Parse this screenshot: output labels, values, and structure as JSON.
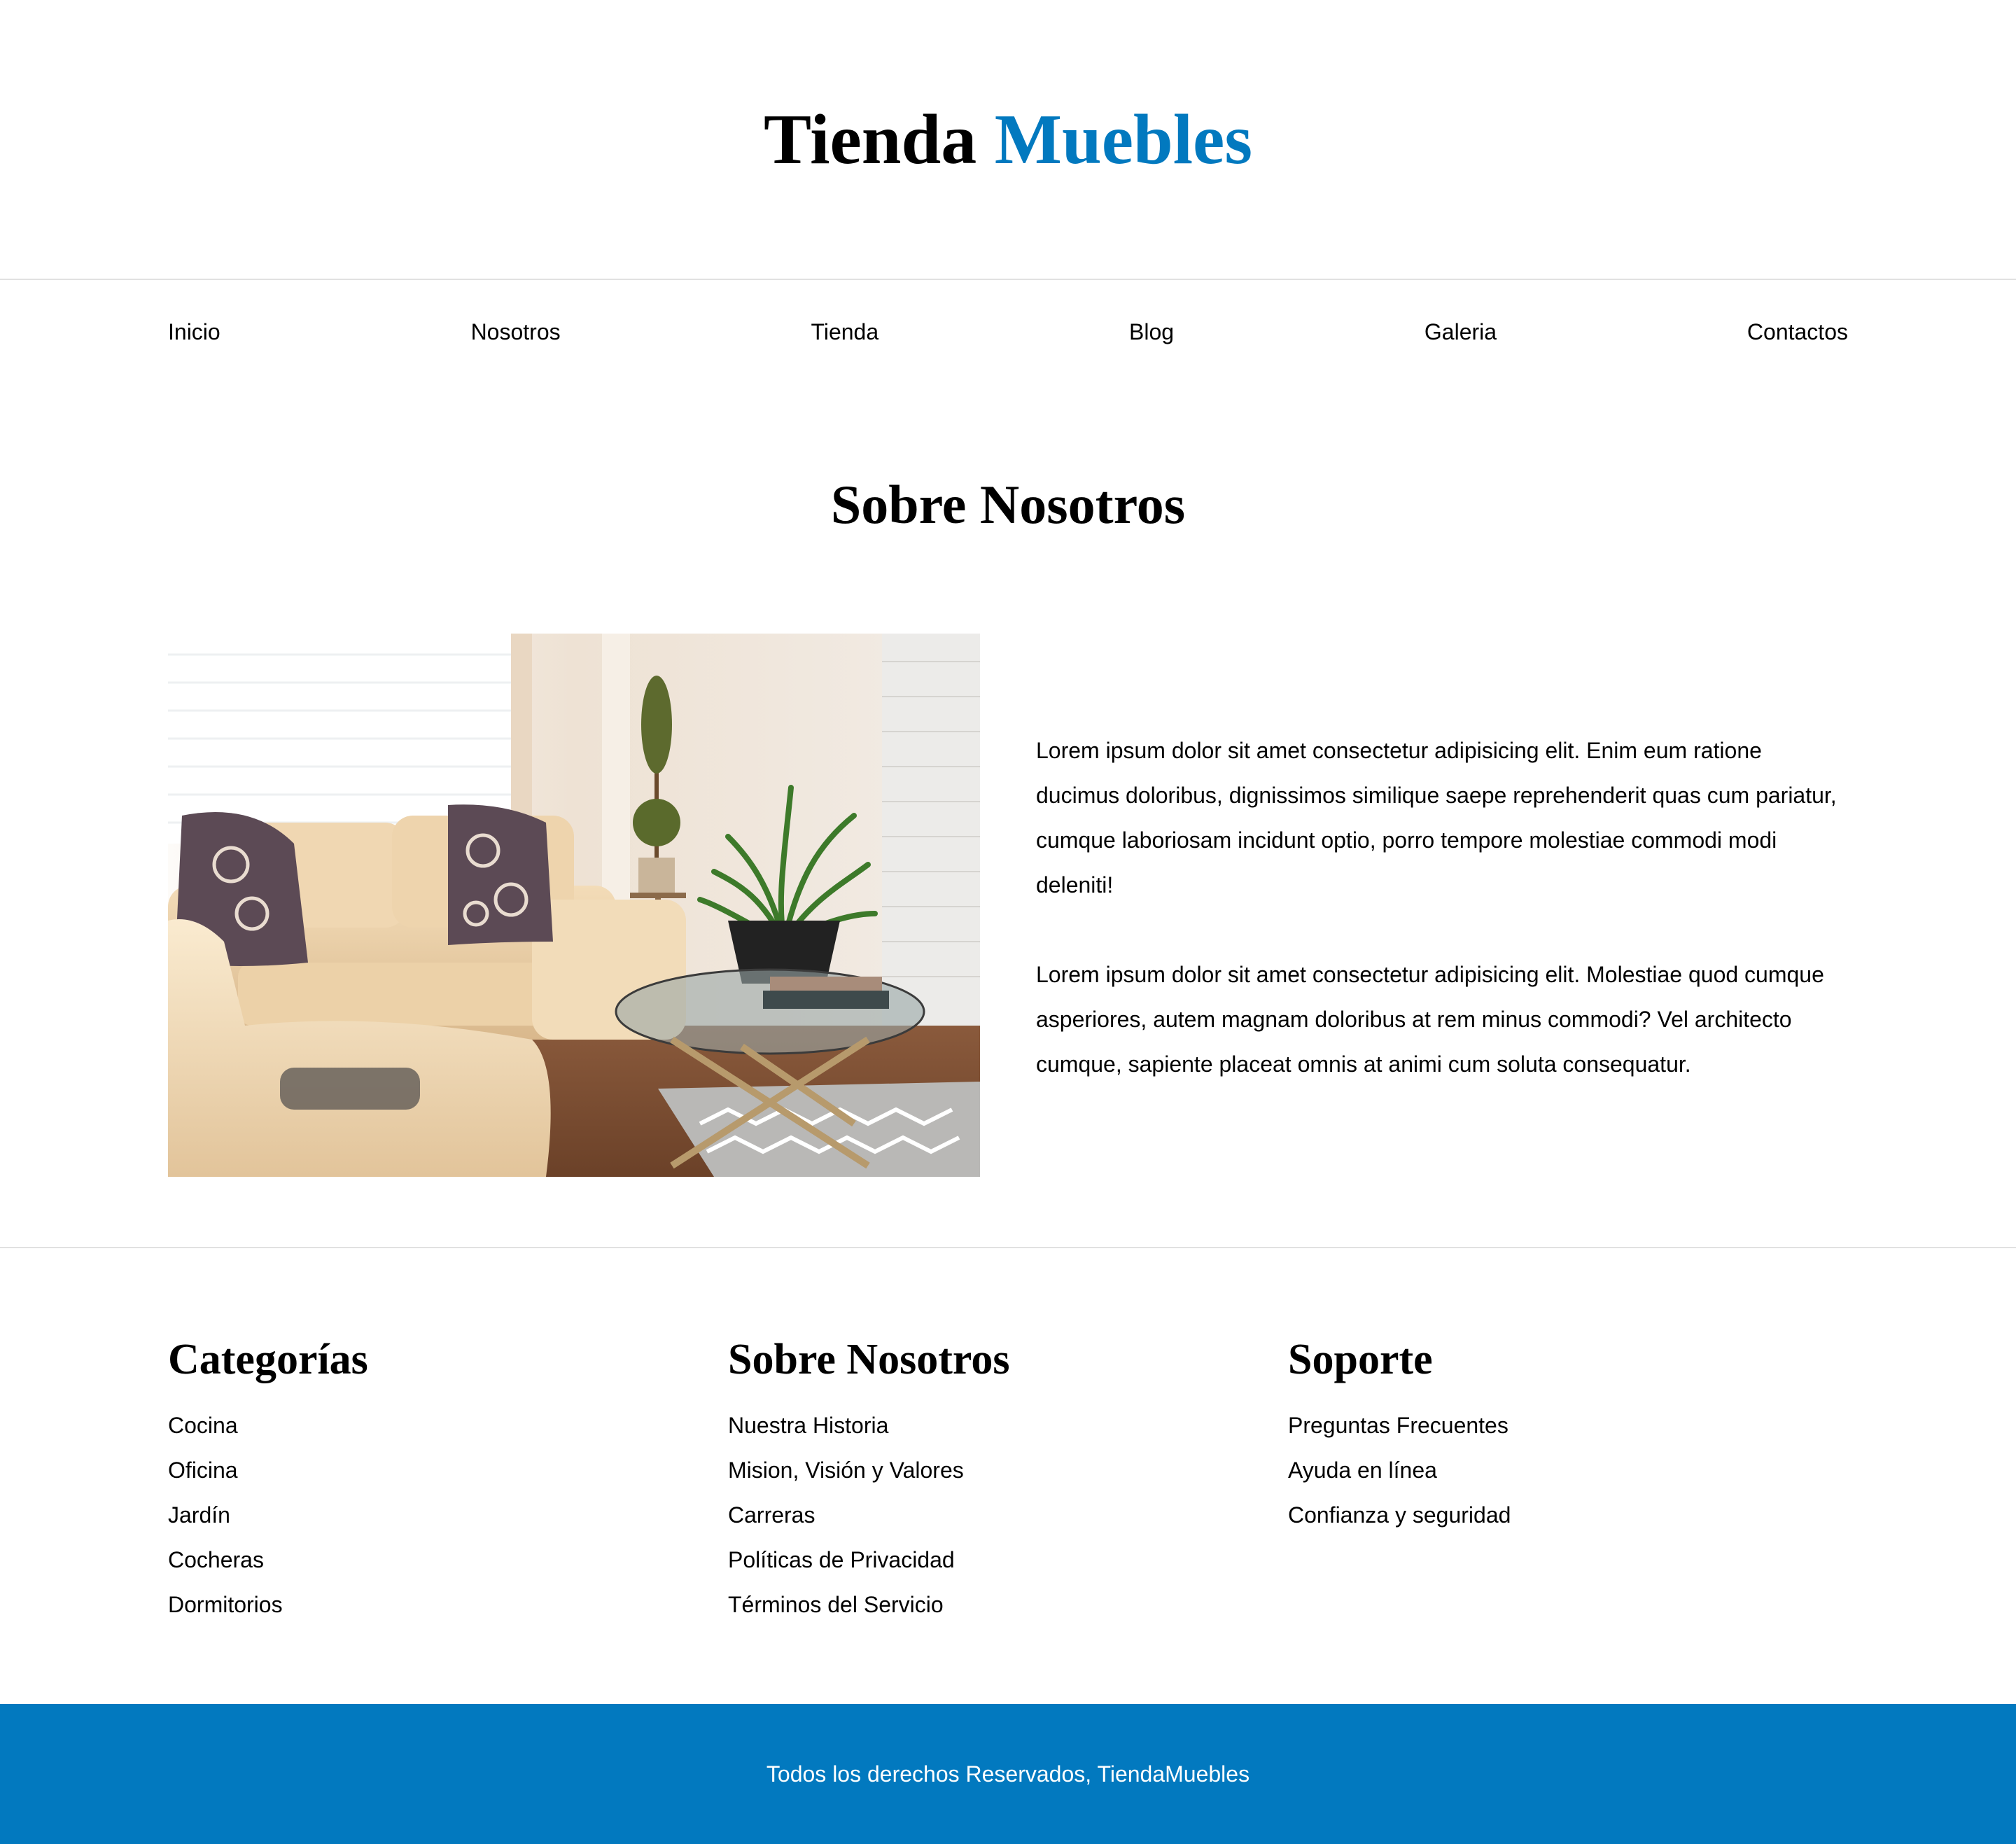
{
  "header": {
    "logo_primary": "Tienda",
    "logo_accent": "Muebles"
  },
  "nav": {
    "items": [
      {
        "label": "Inicio"
      },
      {
        "label": "Nosotros"
      },
      {
        "label": "Tienda"
      },
      {
        "label": "Blog"
      },
      {
        "label": "Galeria"
      },
      {
        "label": "Contactos"
      }
    ]
  },
  "main": {
    "title": "Sobre Nosotros",
    "paragraphs": [
      "Lorem ipsum dolor sit amet consectetur adipisicing elit. Enim eum ratione ducimus doloribus, dignissimos similique saepe reprehenderit quas cum pariatur, cumque laboriosam incidunt optio, porro tempore molestiae commodi modi deleniti!",
      "Lorem ipsum dolor sit amet consectetur adipisicing elit. Molestiae quod cumque asperiores, autem magnam doloribus at rem minus commodi? Vel architecto cumque, sapiente placeat omnis at animi cum soluta consequatur."
    ]
  },
  "footer": {
    "columns": [
      {
        "title": "Categorías",
        "links": [
          "Cocina",
          "Oficina",
          "Jardín",
          "Cocheras",
          "Dormitorios"
        ]
      },
      {
        "title": "Sobre Nosotros",
        "links": [
          "Nuestra Historia",
          "Mision, Visión y Valores",
          "Carreras",
          "Políticas de Privacidad",
          "Términos del Servicio"
        ]
      },
      {
        "title": "Soporte",
        "links": [
          "Preguntas Frecuentes",
          "Ayuda en línea",
          "Confianza y seguridad"
        ]
      }
    ],
    "copyright": "Todos los derechos Reservados, TiendaMuebles"
  },
  "colors": {
    "accent": "#0279bf",
    "divider": "#e1e1e1",
    "text": "#000000"
  }
}
